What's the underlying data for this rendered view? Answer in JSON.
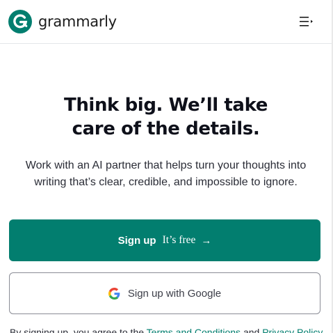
{
  "header": {
    "brand_name": "grammarly",
    "logo_icon": "grammarly-g-logo-icon",
    "menu_icon": "hamburger-menu-icon"
  },
  "hero": {
    "headline_line1": "Think big. We’ll take",
    "headline_line2": "care of the details.",
    "subtext_line1": "Work with an AI partner that helps turn your thoughts into",
    "subtext_line2": "writing that’s clear, credible, and impossible to ignore."
  },
  "cta": {
    "signup_label": "Sign up",
    "signup_note": "It’s free",
    "signup_arrow": "→",
    "google_label": "Sign up with Google",
    "google_icon": "google-g-icon"
  },
  "legal": {
    "prefix": "By signing up, you agree to the ",
    "terms_link": "Terms and Conditions",
    "middle": " and ",
    "privacy_link": "Privacy Policy"
  },
  "colors": {
    "brand_green": "#027e6f",
    "text_dark": "#0e101a",
    "border": "#8a8c95"
  }
}
